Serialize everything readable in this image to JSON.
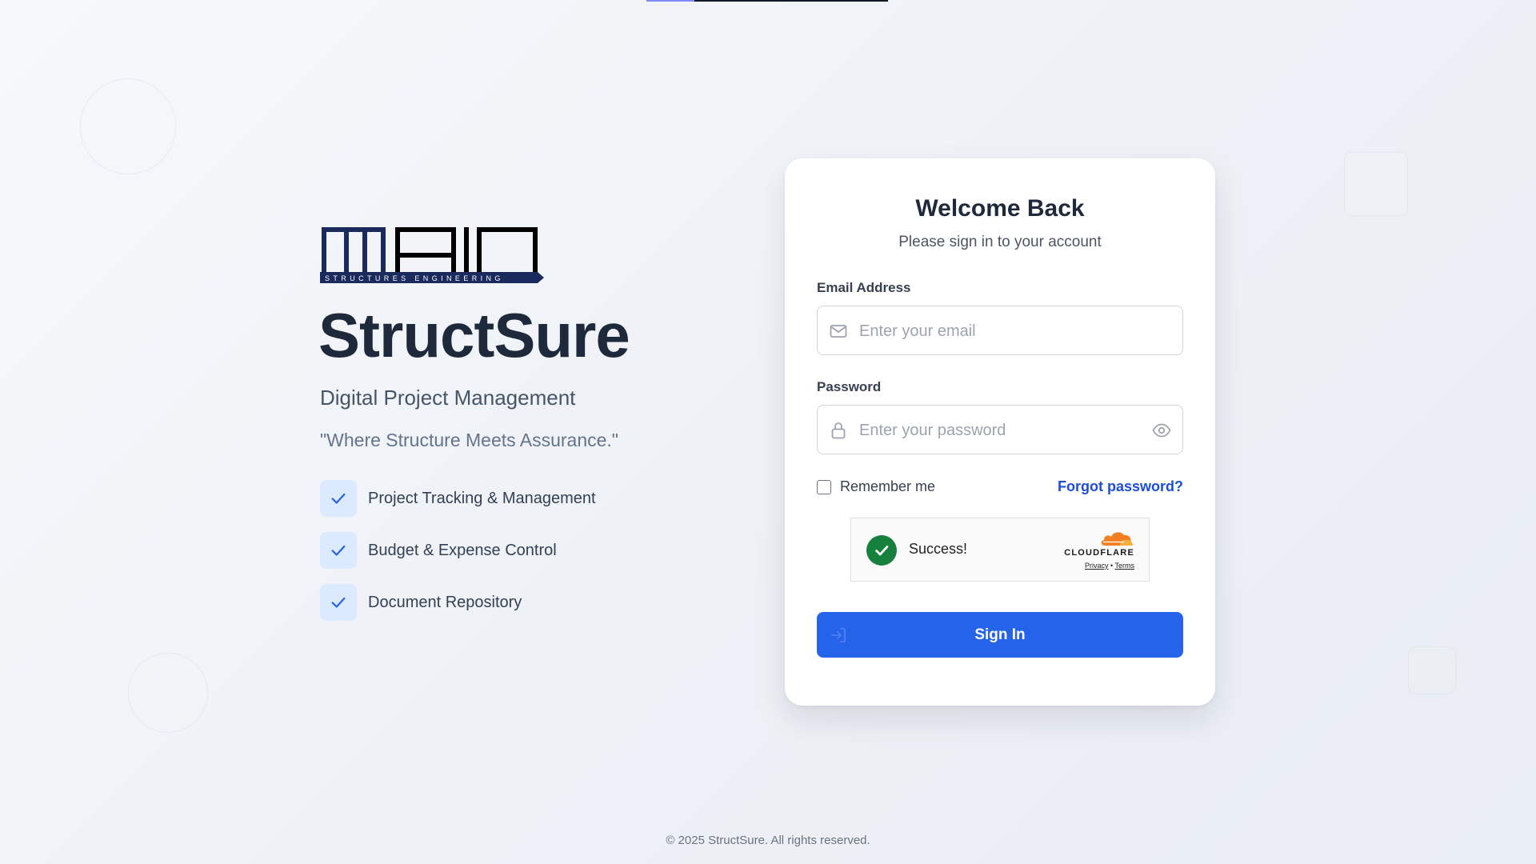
{
  "loading_bar": {
    "progress": 0.2,
    "fill_color": "#818cf8"
  },
  "brand": {
    "logo_main": "MAIN",
    "logo_sub": "STRUCTURES ENGINEERING",
    "title": "StructSure",
    "subtitle": "Digital Project Management",
    "tagline": "\"Where Structure Meets Assurance.\"",
    "features": [
      {
        "label": "Project Tracking & Management",
        "icon": "check-icon"
      },
      {
        "label": "Budget & Expense Control",
        "icon": "check-icon"
      },
      {
        "label": "Document Repository",
        "icon": "check-icon"
      }
    ]
  },
  "login": {
    "title": "Welcome Back",
    "subtitle": "Please sign in to your account",
    "email": {
      "label": "Email Address",
      "placeholder": "Enter your email",
      "value": "",
      "icon": "mail-icon"
    },
    "password": {
      "label": "Password",
      "placeholder": "Enter your password",
      "value": "",
      "icon": "lock-icon",
      "toggle_icon": "eye-icon"
    },
    "remember_label": "Remember me",
    "remember_checked": false,
    "forgot_label": "Forgot password?",
    "captcha": {
      "status": "Success!",
      "brand": "CLOUDFLARE",
      "privacy": "Privacy",
      "separator": "•",
      "terms": "Terms"
    },
    "submit_label": "Sign In",
    "submit_icon": "sign-in-icon"
  },
  "footer": "© 2025 StructSure. All rights reserved.",
  "colors": {
    "accent": "#2563eb",
    "link": "#1d4ed8",
    "success": "#16803c",
    "check_bg": "#dbeafe",
    "navy": "#1b2a5c"
  }
}
